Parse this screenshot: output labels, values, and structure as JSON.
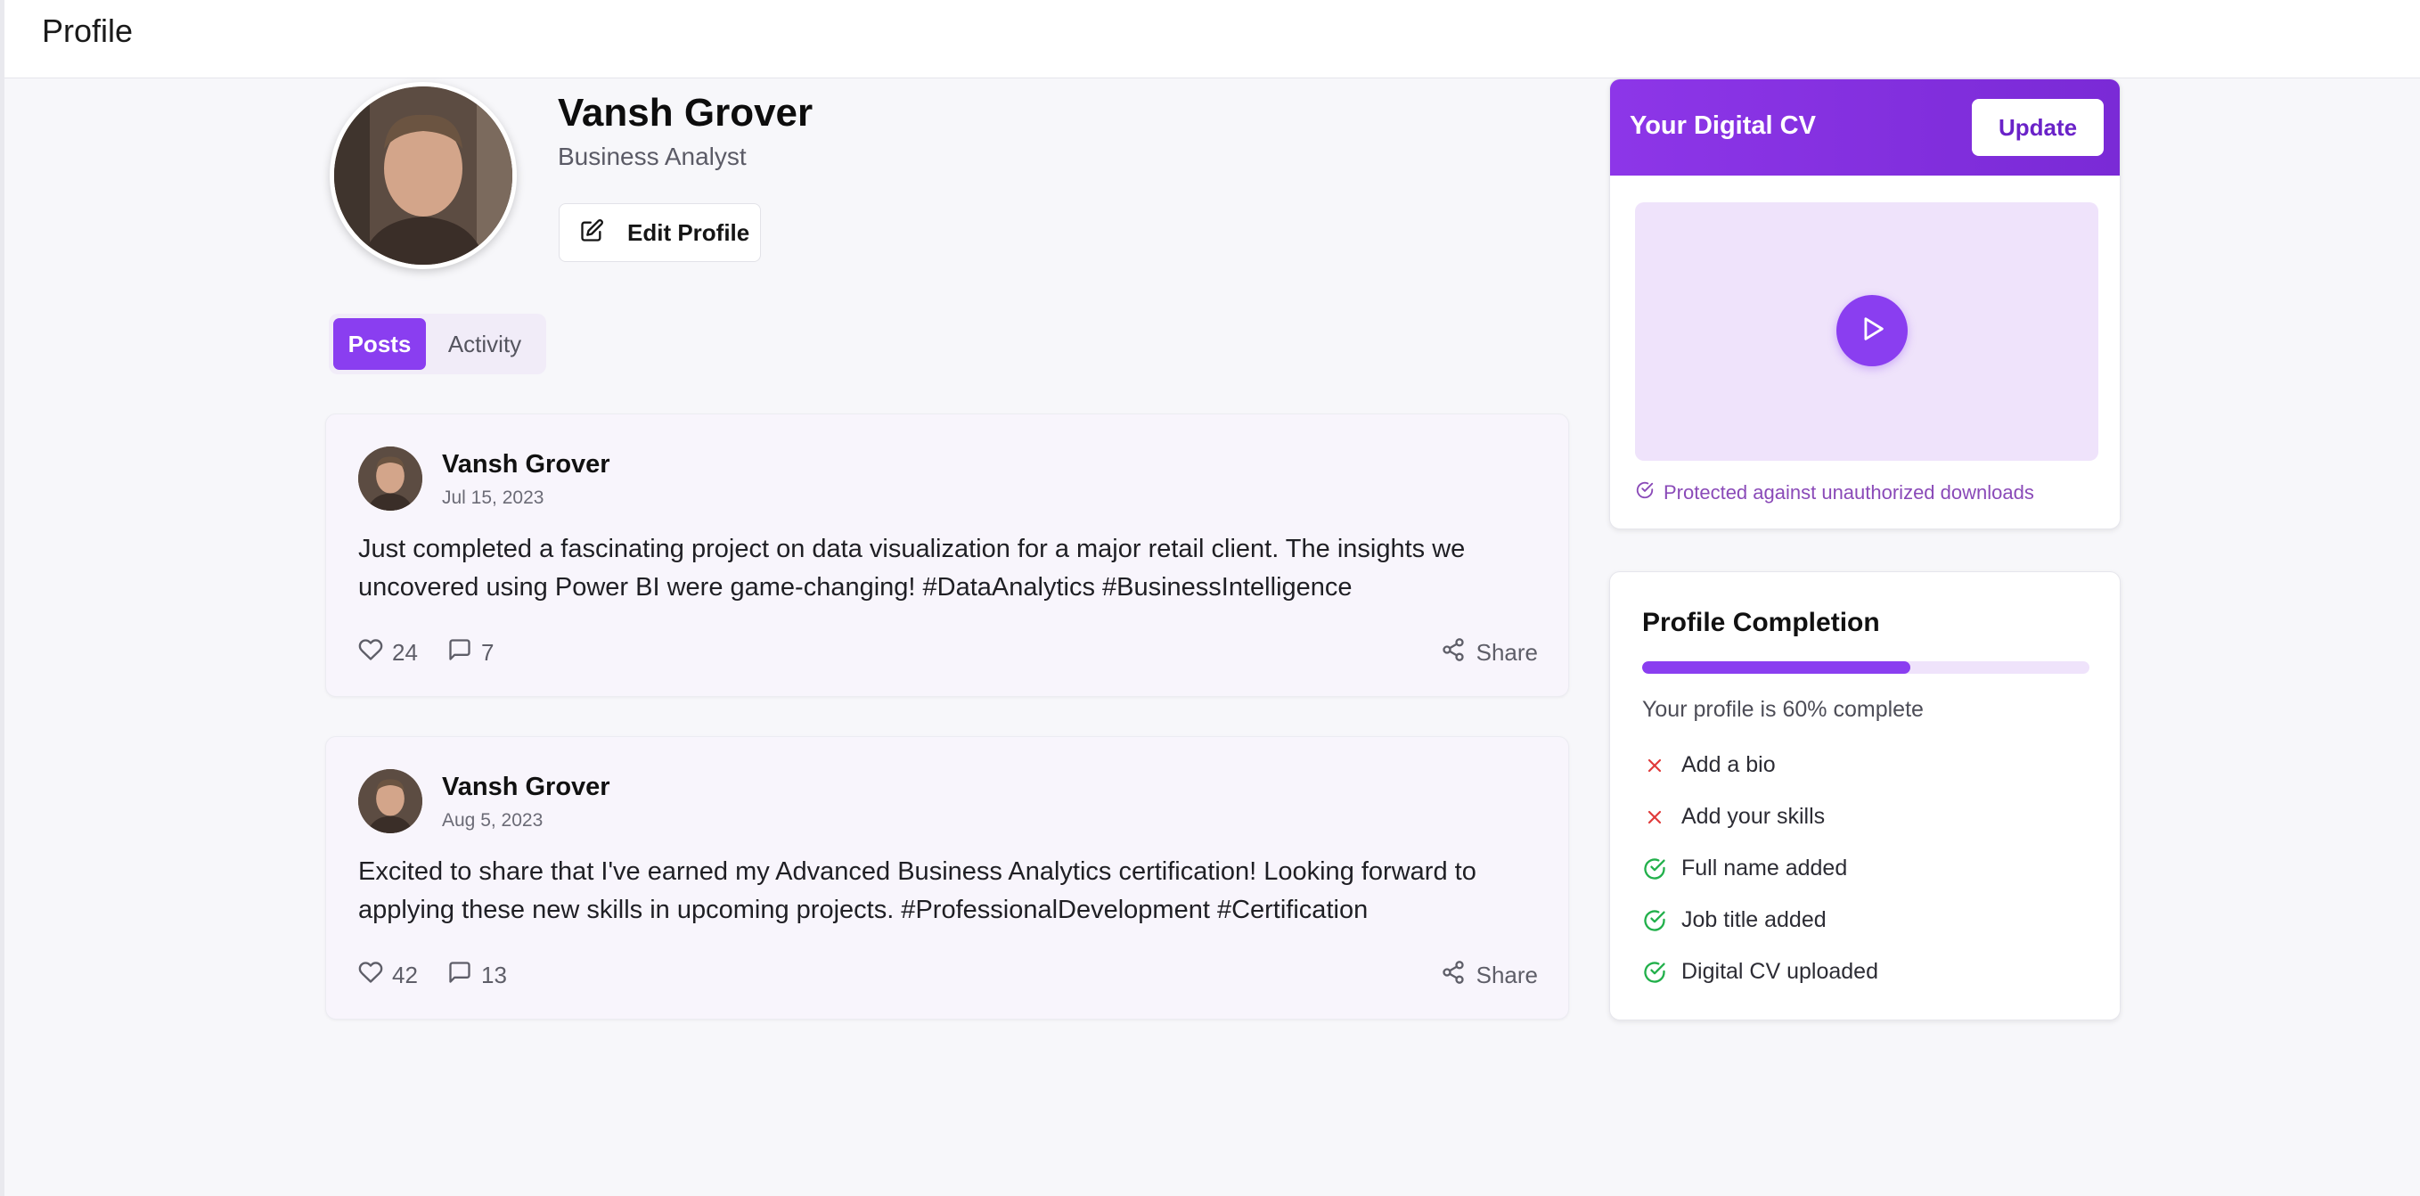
{
  "header": {
    "title": "Profile"
  },
  "profile": {
    "name": "Vansh Grover",
    "role": "Business Analyst",
    "edit_label": "Edit Profile"
  },
  "tabs": [
    {
      "label": "Posts",
      "active": true
    },
    {
      "label": "Activity",
      "active": false
    }
  ],
  "posts": [
    {
      "author": "Vansh Grover",
      "date": "Jul 15, 2023",
      "text": "Just completed a fascinating project on data visualization for a major retail client. The insights we uncovered using Power BI were game-changing! #DataAnalytics #BusinessIntelligence",
      "likes": "24",
      "comments": "7",
      "share_label": "Share"
    },
    {
      "author": "Vansh Grover",
      "date": "Aug 5, 2023",
      "text": "Excited to share that I've earned my Advanced Business Analytics certification! Looking forward to applying these new skills in upcoming projects. #ProfessionalDevelopment #Certification",
      "likes": "42",
      "comments": "13",
      "share_label": "Share"
    }
  ],
  "cv": {
    "title": "Your Digital CV",
    "update_label": "Update",
    "protected_note": "Protected against unauthorized downloads"
  },
  "completion": {
    "title": "Profile Completion",
    "percent_value": 0.6,
    "percent_text": "Your profile is 60% complete",
    "items": [
      {
        "label": "Add a bio",
        "done": false
      },
      {
        "label": "Add your skills",
        "done": false
      },
      {
        "label": "Full name added",
        "done": true
      },
      {
        "label": "Job title added",
        "done": true
      },
      {
        "label": "Digital CV uploaded",
        "done": true
      }
    ]
  },
  "colors": {
    "accent": "#8a3ef0",
    "accent_dark": "#7a2ad6",
    "success": "#22b04b",
    "danger": "#e03a3a"
  },
  "icons": {
    "edit": "edit-square-icon",
    "like": "heart-icon",
    "comment": "comment-icon",
    "share": "share-icon",
    "play": "play-icon",
    "protected": "check-circle-icon",
    "done": "check-circle-icon",
    "missing": "x-icon"
  }
}
